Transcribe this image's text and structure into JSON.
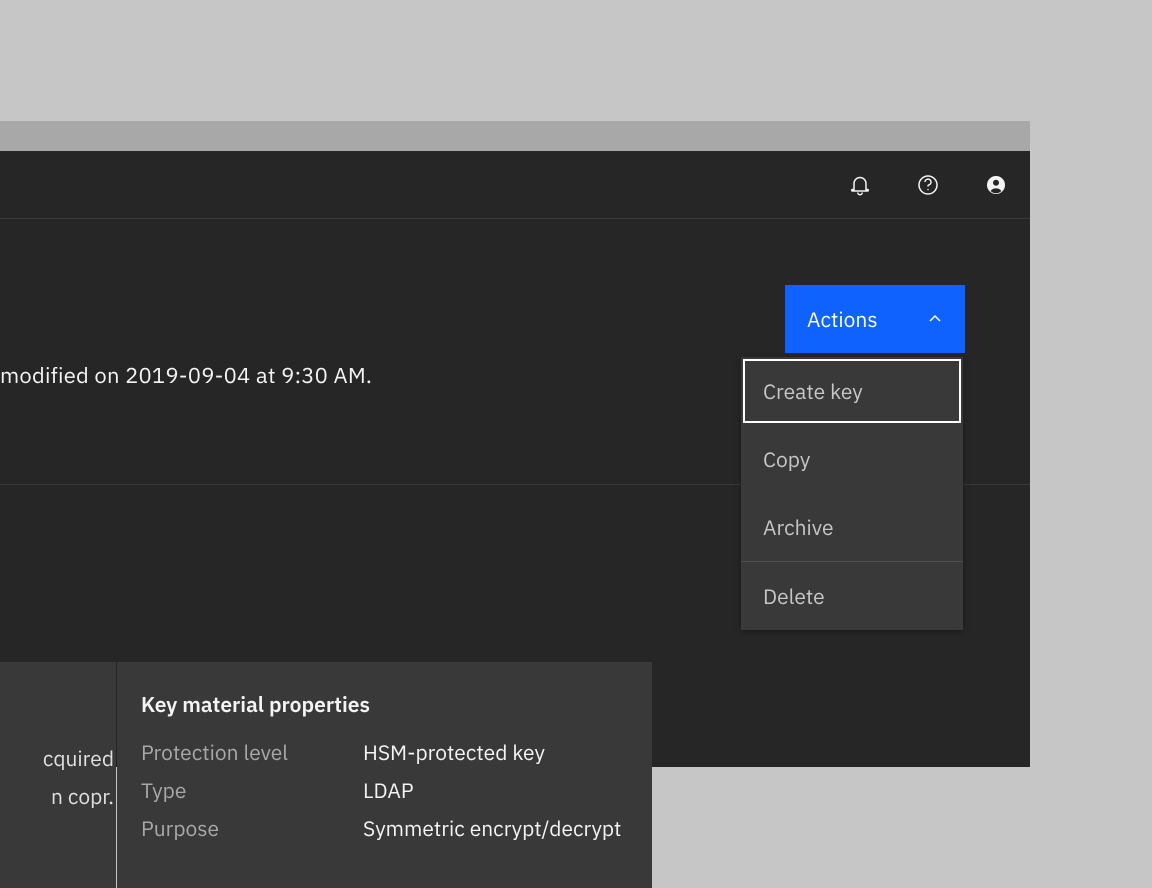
{
  "header": {
    "icons": [
      "notification",
      "help",
      "account"
    ]
  },
  "meta": {
    "modified_text": "modified on 2019-09-04 at 9:30 AM."
  },
  "actions": {
    "label": "Actions",
    "items": {
      "create_key": "Create key",
      "copy": "Copy",
      "archive": "Archive",
      "delete": "Delete"
    }
  },
  "left_card": {
    "line1": "cquired",
    "line2": "n copr."
  },
  "properties": {
    "title": "Key material properties",
    "rows": {
      "protection": {
        "label": "Protection level",
        "value": "HSM-protected key"
      },
      "type": {
        "label": "Type",
        "value": "LDAP"
      },
      "purpose": {
        "label": "Purpose",
        "value": "Symmetric encrypt/decrypt"
      }
    }
  }
}
